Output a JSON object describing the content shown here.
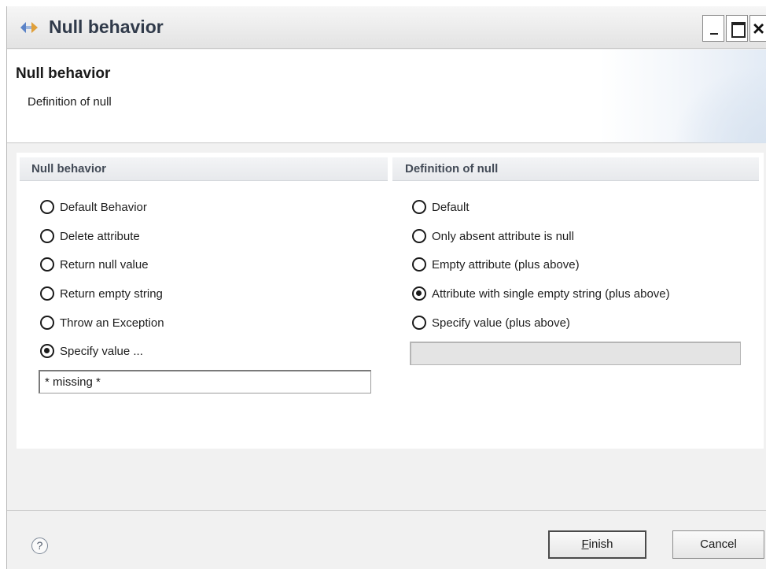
{
  "window": {
    "title": "Null behavior",
    "colors": {
      "title_text": "#303a4a",
      "panel_bg": "#ffffff",
      "frame_bg": "#f1f1f1"
    }
  },
  "header": {
    "title": "Null behavior",
    "description": "Definition of null"
  },
  "null_behavior_group": {
    "title": "Null behavior",
    "options": [
      {
        "label": "Default Behavior",
        "checked": false
      },
      {
        "label": "Delete attribute",
        "checked": false
      },
      {
        "label": "Return null value",
        "checked": false
      },
      {
        "label": "Return empty string",
        "checked": false
      },
      {
        "label": "Throw an Exception",
        "checked": false
      },
      {
        "label": "Specify value ...",
        "checked": true
      }
    ],
    "value_field": {
      "value": "* missing *",
      "enabled": true
    }
  },
  "definition_group": {
    "title": "Definition of null",
    "options": [
      {
        "label": "Default",
        "checked": false
      },
      {
        "label": "Only absent attribute is null",
        "checked": false
      },
      {
        "label": "Empty attribute (plus above)",
        "checked": false
      },
      {
        "label": "Attribute with single empty string (plus above)",
        "checked": true
      },
      {
        "label": "Specify value (plus above)",
        "checked": false
      }
    ],
    "value_field": {
      "value": "",
      "enabled": false
    }
  },
  "footer": {
    "help_icon": "help-icon",
    "help_glyph": "?",
    "finish_mnemonic": "F",
    "finish_rest": "inish",
    "cancel_label": "Cancel"
  }
}
